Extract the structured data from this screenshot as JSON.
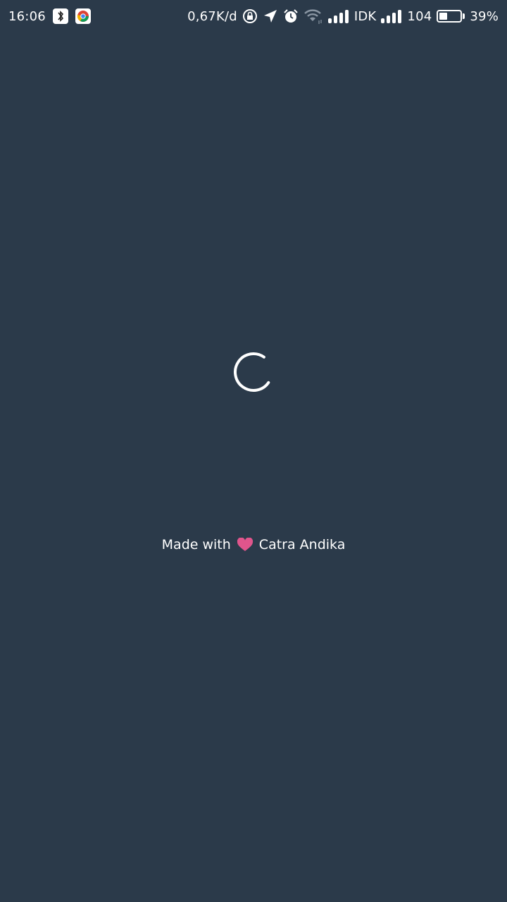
{
  "status_bar": {
    "time": "16:06",
    "network_speed": "0,67K/d",
    "carrier_1": "IDK",
    "carrier_2": "104",
    "battery_percent": "39%",
    "battery_level": 0.39,
    "icons": [
      "bluetooth-app-icon",
      "chrome-icon",
      "rotation-lock-icon",
      "location-icon",
      "alarm-icon",
      "wifi-icon",
      "signal-icon",
      "signal-icon"
    ]
  },
  "loading": {
    "spinner_color": "#ffffff"
  },
  "credit": {
    "prefix": "Made with",
    "author": "Catra Andika",
    "heart_color": "#e0558c"
  },
  "colors": {
    "background": "#2b3a4a",
    "text": "#ffffff"
  }
}
